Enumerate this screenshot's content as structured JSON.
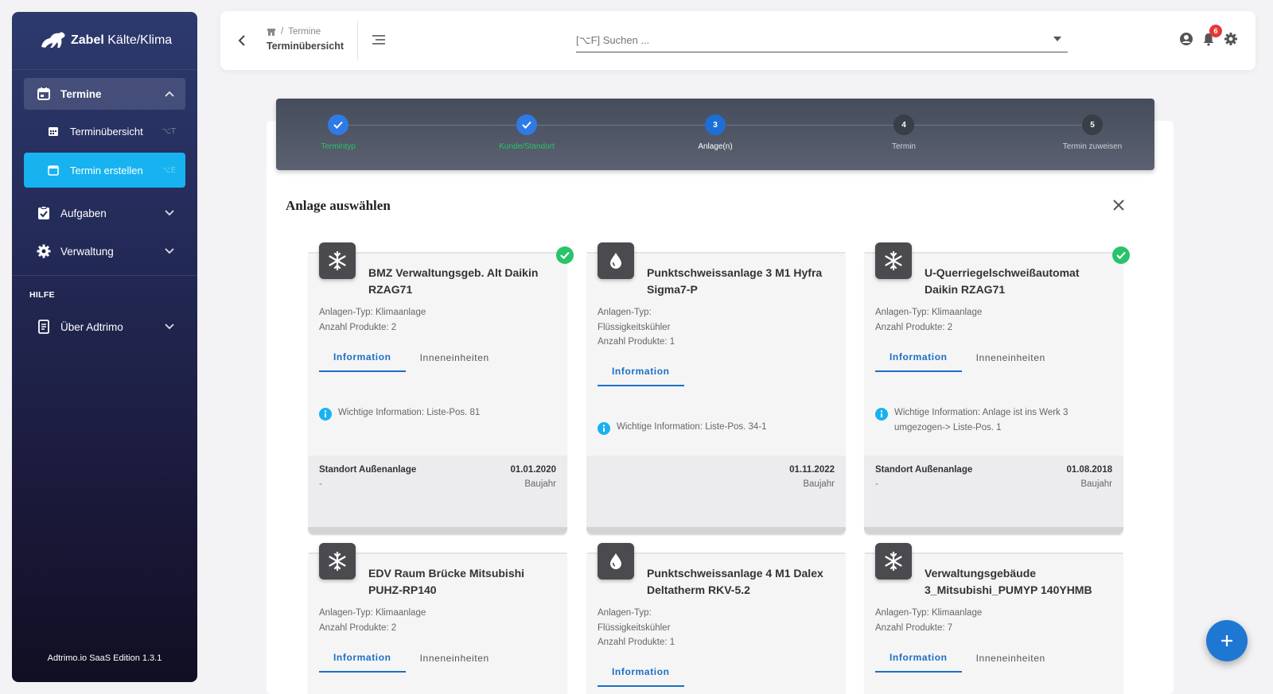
{
  "app": {
    "brand_bold": "Zabel",
    "brand_rest": " Kälte/Klima",
    "version": "Adtrimo.io SaaS Edition 1.3.1"
  },
  "sidebar": {
    "termine": "Termine",
    "sub_overview": "Terminübersicht",
    "sub_overview_kbd": "⌥T",
    "sub_create": "Termin erstellen",
    "sub_create_kbd": "⌥E",
    "aufgaben": "Aufgaben",
    "verwaltung": "Verwaltung",
    "help_label": "HILFE",
    "about": "Über Adtrimo"
  },
  "topbar": {
    "crumb_parent": "Termine",
    "crumb_sep": "/",
    "crumb_title": "Terminübersicht",
    "search_placeholder": "[⌥F] Suchen ...",
    "notifications_count": "6"
  },
  "stepper": {
    "steps": [
      {
        "label": "Termintyp",
        "state": "done"
      },
      {
        "label": "Kunde/Standort",
        "state": "done"
      },
      {
        "label": "Anlage(n)",
        "num": "3",
        "state": "current"
      },
      {
        "label": "Termin",
        "num": "4",
        "state": "todo"
      },
      {
        "label": "Termin zuweisen",
        "num": "5",
        "state": "todo"
      }
    ]
  },
  "section": {
    "title": "Anlage auswählen"
  },
  "tabs": {
    "information": "Information",
    "units": "Inneneinheiten"
  },
  "labels": {
    "baujahr": "Baujahr"
  },
  "plants": [
    {
      "title": "BMZ Verwaltungsgeb. Alt Daikin RZAG71",
      "icon": "snowflake-icon",
      "selected": true,
      "meta1": "Anlagen-Typ: Klimaanlage",
      "meta2": "Anzahl Produkte: 2",
      "info": "Wichtige Information: Liste-Pos. 81",
      "location": "Standort Außenanlage",
      "location_sub": "-",
      "date": "01.01.2020"
    },
    {
      "title": "Punktschweissanlage 3 M1 Hyfra Sigma7-P",
      "icon": "drop-icon",
      "selected": false,
      "meta1": "Anlagen-Typ:",
      "meta2": "Flüssigkeitskühler",
      "meta3": "Anzahl Produkte: 1",
      "info": "Wichtige Information: Liste-Pos. 34-1",
      "location": "",
      "location_sub": "",
      "date": "01.11.2022"
    },
    {
      "title": "U-Querriegelschweißautomat Daikin RZAG71",
      "icon": "snowflake-icon",
      "selected": true,
      "meta1": "Anlagen-Typ: Klimaanlage",
      "meta2": "Anzahl Produkte: 2",
      "info": "Wichtige Information: Anlage ist ins Werk 3 umgezogen-> Liste-Pos. 1",
      "location": "Standort Außenanlage",
      "location_sub": "-",
      "date": "01.08.2018"
    },
    {
      "title": "EDV Raum Brücke Mitsubishi PUHZ-RP140",
      "icon": "snowflake-icon",
      "selected": false,
      "meta1": "Anlagen-Typ: Klimaanlage",
      "meta2": "Anzahl Produkte: 2"
    },
    {
      "title": "Punktschweissanlage 4 M1 Dalex Deltatherm RKV-5.2",
      "icon": "drop-icon",
      "selected": false,
      "meta1": "Anlagen-Typ:",
      "meta2": "Flüssigkeitskühler",
      "meta3": "Anzahl Produkte: 1"
    },
    {
      "title": "Verwaltungsgebäude 3_Mitsubishi_PUMYP 140YHMB",
      "icon": "snowflake-icon",
      "selected": false,
      "meta1": "Anlagen-Typ: Klimaanlage",
      "meta2": "Anzahl Produkte: 7"
    }
  ],
  "colors": {
    "accent": "#17b3f0",
    "primary": "#1b6fc4",
    "success": "#27c46a"
  }
}
